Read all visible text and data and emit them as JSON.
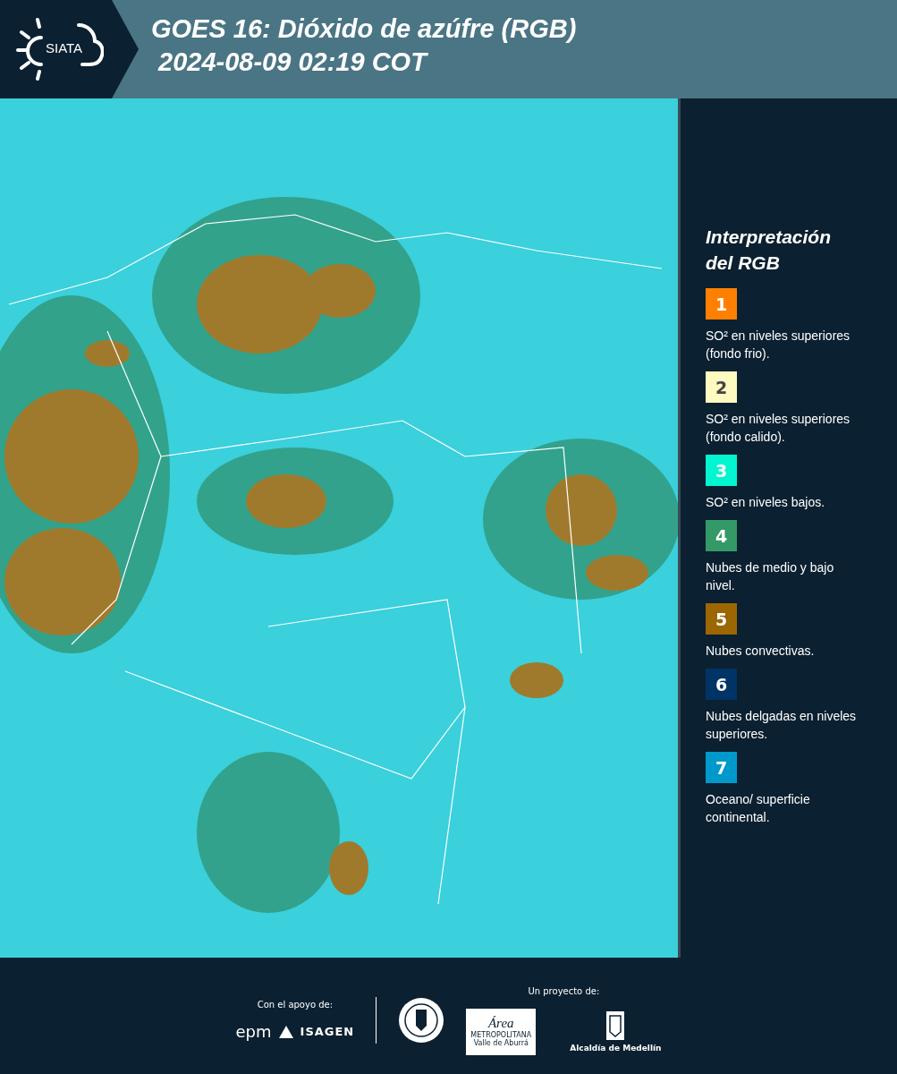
{
  "header": {
    "logo": "SIATA",
    "title_line_1": "GOES 16: Dióxido de azúfre (RGB)",
    "title_line_2": "2024-08-09 02:19 COT"
  },
  "legend": {
    "title_line_1": "Interpretación",
    "title_line_2": "del RGB",
    "items": [
      {
        "number": "1",
        "color": "#ff8000",
        "text": "SO² en niveles superiores (fondo frio)."
      },
      {
        "number": "2",
        "color": "#fffac0",
        "text": "SO² en niveles superiores (fondo calido)."
      },
      {
        "number": "3",
        "color": "#00f5d0",
        "text": "SO² en niveles bajos."
      },
      {
        "number": "4",
        "color": "#339966",
        "text": "Nubes de medio y bajo nivel."
      },
      {
        "number": "5",
        "color": "#9c6600",
        "text": "Nubes convectivas."
      },
      {
        "number": "6",
        "color": "#003366",
        "text": "Nubes delgadas en niveles superiores."
      },
      {
        "number": "7",
        "color": "#0099cc",
        "text": "Oceano/ superficie continental."
      }
    ]
  },
  "footer": {
    "support_label": "Con el apoyo de:",
    "project_label": "Un proyecto de:",
    "epm": "epm",
    "isagen": "ISAGEN",
    "area_name": "Área",
    "area_line_1": "METROPOLITANA",
    "area_line_2": "Valle de Aburrá",
    "alcaldia": "Alcaldía de Medellín"
  }
}
